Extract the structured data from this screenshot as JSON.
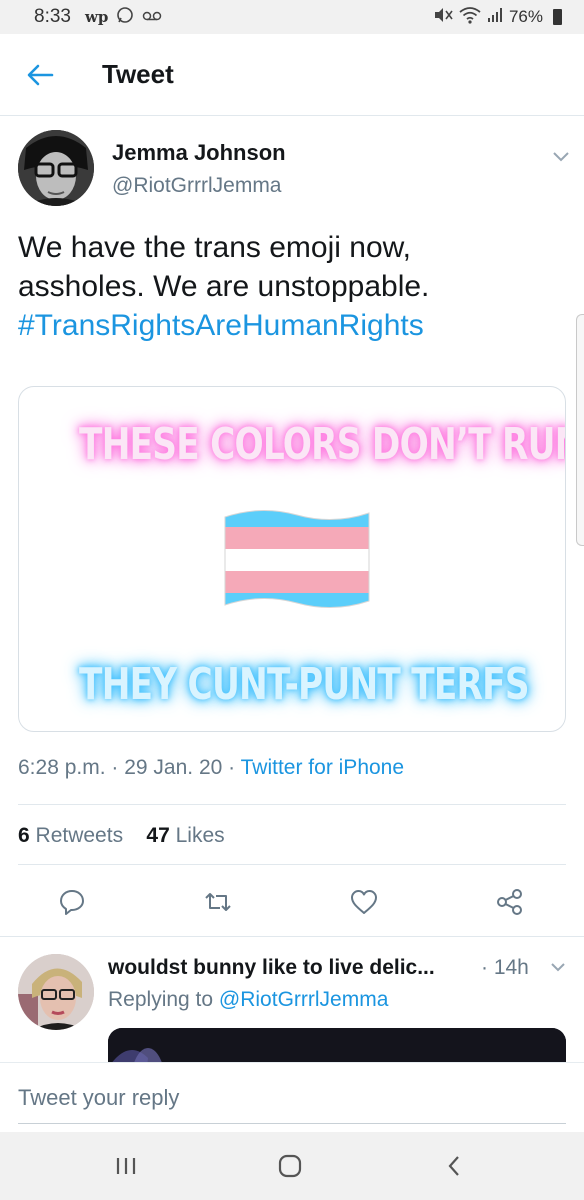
{
  "status_bar": {
    "time": "8:33",
    "app_icons": [
      "wp",
      "whatsapp-icon",
      "voicemail-icon"
    ],
    "battery": "76%"
  },
  "header": {
    "title": "Tweet"
  },
  "tweet": {
    "author_name": "Jemma Johnson",
    "author_handle": "@RiotGrrrlJemma",
    "text_line1": "We have the trans emoji now,",
    "text_line2": "assholes.  We are unstoppable.",
    "hashtag": "#TransRightsAreHumanRights",
    "media": {
      "top_text": "THESE COLORS DON’T RUN",
      "bottom_text": "THEY CUNT-PUNT TERFS",
      "flag_colors": [
        "#5bcefa",
        "#f5a9b8",
        "#ffffff",
        "#f5a9b8",
        "#5bcefa"
      ]
    },
    "time": "6:28 p.m.",
    "date": "29 Jan. 20",
    "source": "Twitter for iPhone",
    "retweets_count": "6",
    "retweets_label": "Retweets",
    "likes_count": "47",
    "likes_label": "Likes"
  },
  "reply": {
    "name": "wouldst bunny like to live delic...",
    "time": "14h",
    "replying_prefix": "Replying to",
    "replying_to": "@RiotGrrrlJemma"
  },
  "reply_bar": {
    "placeholder": "Tweet your reply"
  },
  "colors": {
    "accent": "#1b95e0",
    "secondary_text": "#657786",
    "primary_text": "#14171a"
  }
}
